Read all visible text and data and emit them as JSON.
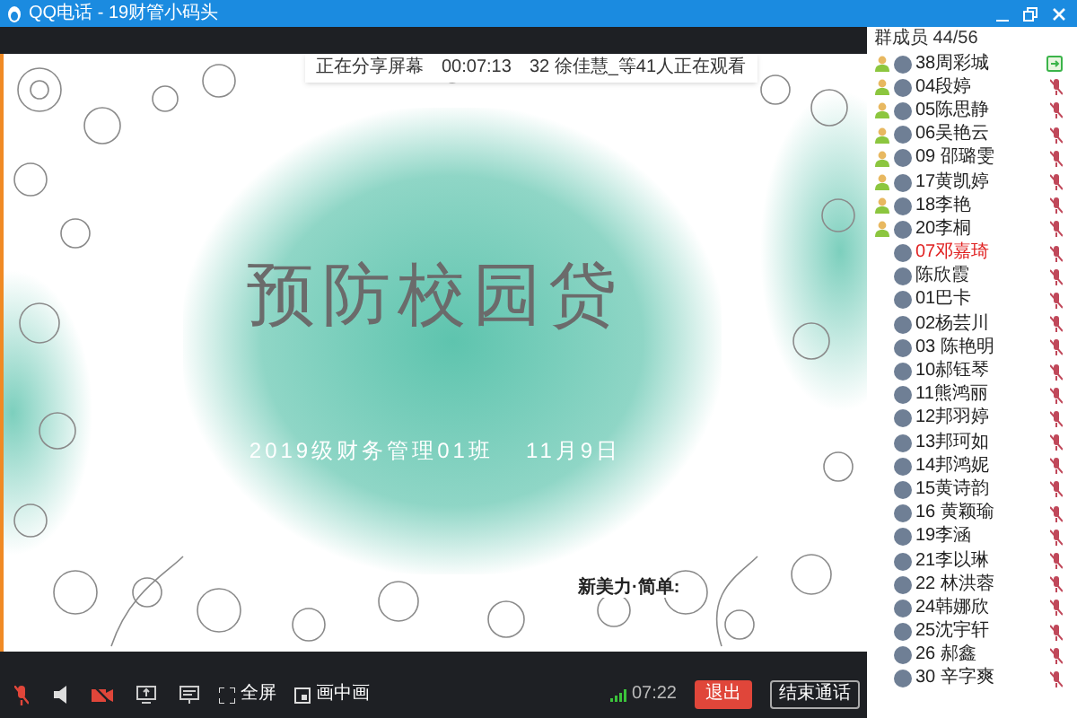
{
  "window": {
    "title": "QQ电话 - 19财管小码头"
  },
  "share_banner": {
    "status": "正在分享屏幕",
    "elapsed": "00:07:13",
    "viewers": "32 徐佳慧_等41人正在观看"
  },
  "slide": {
    "title": "预防校园贷",
    "subtitle": "2019级财务管理01班",
    "date": "11月9日",
    "footer": "新美力·简单:"
  },
  "toolbar": {
    "mic_muted": true,
    "camera_off": true,
    "fullscreen": "全屏",
    "pip": "画中画",
    "time": "07:22",
    "exit": "退出",
    "end_call": "结束通话"
  },
  "members_header": "群成员 44/56",
  "members": [
    {
      "name": "38周彩城",
      "presence": true,
      "sharing": true,
      "muted": false,
      "highlight": false
    },
    {
      "name": "04段婷",
      "presence": true,
      "sharing": false,
      "muted": true,
      "highlight": false
    },
    {
      "name": "05陈思静",
      "presence": true,
      "sharing": false,
      "muted": true,
      "highlight": false
    },
    {
      "name": "06吴艳云",
      "presence": true,
      "sharing": false,
      "muted": true,
      "highlight": false
    },
    {
      "name": "09 邵璐雯",
      "presence": true,
      "sharing": false,
      "muted": true,
      "highlight": false
    },
    {
      "name": "17黄凯婷",
      "presence": true,
      "sharing": false,
      "muted": true,
      "highlight": false
    },
    {
      "name": "18李艳",
      "presence": true,
      "sharing": false,
      "muted": true,
      "highlight": false
    },
    {
      "name": "20李桐",
      "presence": true,
      "sharing": false,
      "muted": true,
      "highlight": false
    },
    {
      "name": "07邓嘉琦",
      "presence": false,
      "sharing": false,
      "muted": true,
      "highlight": true
    },
    {
      "name": "陈欣霞",
      "presence": false,
      "sharing": false,
      "muted": true,
      "highlight": false
    },
    {
      "name": "01巴卡",
      "presence": false,
      "sharing": false,
      "muted": true,
      "highlight": false
    },
    {
      "name": "02杨芸川",
      "presence": false,
      "sharing": false,
      "muted": true,
      "highlight": false
    },
    {
      "name": "03 陈艳明",
      "presence": false,
      "sharing": false,
      "muted": true,
      "highlight": false
    },
    {
      "name": "10郝钰琴",
      "presence": false,
      "sharing": false,
      "muted": true,
      "highlight": false
    },
    {
      "name": "11熊鸿丽",
      "presence": false,
      "sharing": false,
      "muted": true,
      "highlight": false
    },
    {
      "name": "12邦羽婷",
      "presence": false,
      "sharing": false,
      "muted": true,
      "highlight": false
    },
    {
      "name": "13邦珂如",
      "presence": false,
      "sharing": false,
      "muted": true,
      "highlight": false
    },
    {
      "name": "14邦鸿妮",
      "presence": false,
      "sharing": false,
      "muted": true,
      "highlight": false
    },
    {
      "name": "15黄诗韵",
      "presence": false,
      "sharing": false,
      "muted": true,
      "highlight": false
    },
    {
      "name": "16 黄颖瑜",
      "presence": false,
      "sharing": false,
      "muted": true,
      "highlight": false
    },
    {
      "name": "19李涵",
      "presence": false,
      "sharing": false,
      "muted": true,
      "highlight": false
    },
    {
      "name": "21李以琳",
      "presence": false,
      "sharing": false,
      "muted": true,
      "highlight": false
    },
    {
      "name": "22 林洪蓉",
      "presence": false,
      "sharing": false,
      "muted": true,
      "highlight": false
    },
    {
      "name": "24韩娜欣",
      "presence": false,
      "sharing": false,
      "muted": true,
      "highlight": false
    },
    {
      "name": "25沈宇轩",
      "presence": false,
      "sharing": false,
      "muted": true,
      "highlight": false
    },
    {
      "name": "26 郝鑫",
      "presence": false,
      "sharing": false,
      "muted": true,
      "highlight": false
    },
    {
      "name": "30 辛字爽",
      "presence": false,
      "sharing": false,
      "muted": true,
      "highlight": false
    }
  ]
}
